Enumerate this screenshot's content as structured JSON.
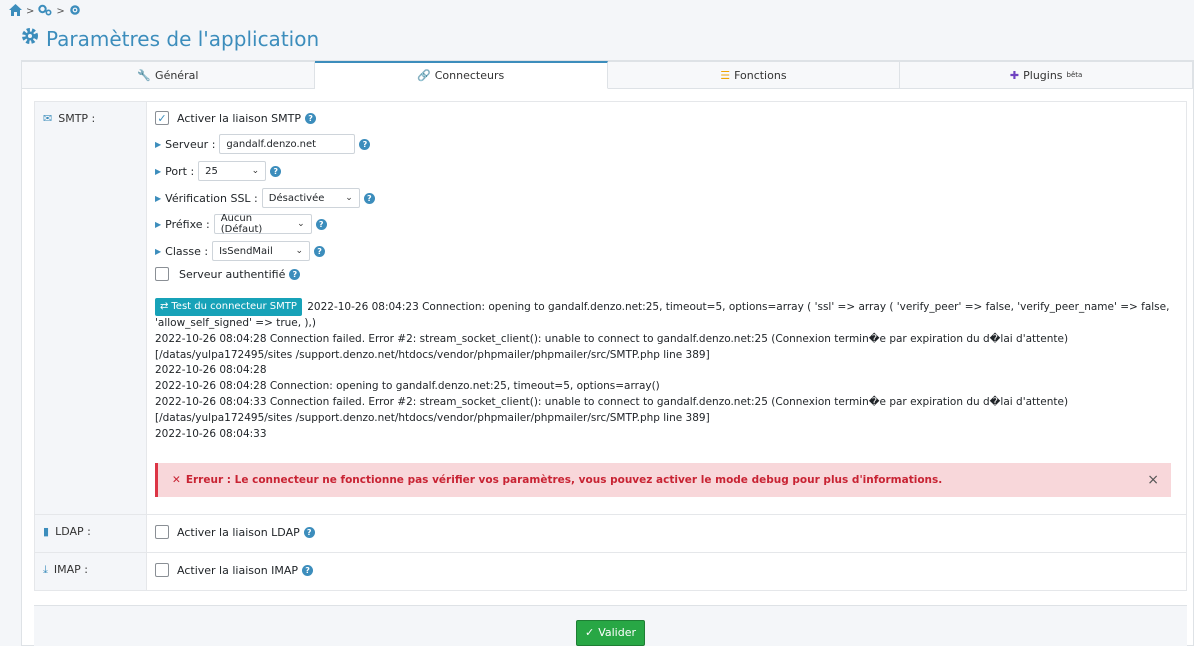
{
  "page": {
    "title": "Paramètres de l'application"
  },
  "breadcrumb": {
    "icons": [
      "home-icon",
      "gears-icon",
      "gear-icon"
    ]
  },
  "tabs": [
    {
      "label": "Général",
      "icon": "wrench-icon"
    },
    {
      "label": "Connecteurs",
      "icon": "link-icon"
    },
    {
      "label": "Fonctions",
      "icon": "list-icon"
    },
    {
      "label": "Plugins",
      "sup": "bêta",
      "icon": "puzzle-icon"
    }
  ],
  "smtp": {
    "label": "SMTP :",
    "enable_label": "Activer la liaison SMTP",
    "server_label": "Serveur :",
    "server_value": "gandalf.denzo.net",
    "port_label": "Port :",
    "port_value": "25",
    "ssl_label": "Vérification SSL :",
    "ssl_value": "Désactivée",
    "prefix_label": "Préfixe :",
    "prefix_value": "Aucun (Défaut)",
    "class_label": "Classe :",
    "class_value": "IsSendMail",
    "auth_label": "Serveur authentifié",
    "test_button": "Test du connecteur SMTP",
    "log_first": "2022-10-26 08:04:23 Connection: opening to gandalf.denzo.net:25, timeout=5, options=array ( 'ssl' => array ( 'verify_peer' => false, 'verify_peer_name' => false, 'allow_self_signed' => true, ),)",
    "log_lines": [
      "2022-10-26 08:04:28 Connection failed. Error #2: stream_socket_client(): unable to connect to gandalf.denzo.net:25 (Connexion termin�e par expiration du d�lai d'attente) [/datas/yulpa172495/sites /support.denzo.net/htdocs/vendor/phpmailer/phpmailer/src/SMTP.php line 389]",
      "2022-10-26 08:04:28",
      "2022-10-26 08:04:28 Connection: opening to gandalf.denzo.net:25, timeout=5, options=array()",
      "2022-10-26 08:04:33 Connection failed. Error #2: stream_socket_client(): unable to connect to gandalf.denzo.net:25 (Connexion termin�e par expiration du d�lai d'attente) [/datas/yulpa172495/sites /support.denzo.net/htdocs/vendor/phpmailer/phpmailer/src/SMTP.php line 389]",
      "2022-10-26 08:04:33"
    ],
    "error_message": "Erreur : Le connecteur ne fonctionne pas vérifier vos paramètres, vous pouvez activer le mode debug pour plus d'informations."
  },
  "ldap": {
    "label": "LDAP :",
    "enable_label": "Activer la liaison LDAP"
  },
  "imap": {
    "label": "IMAP :",
    "enable_label": "Activer la liaison IMAP"
  },
  "footer": {
    "validate_label": "Valider"
  },
  "colors": {
    "primary": "#3c8dbc",
    "success": "#28a745",
    "info": "#17a2b8",
    "danger": "#dc3545"
  }
}
